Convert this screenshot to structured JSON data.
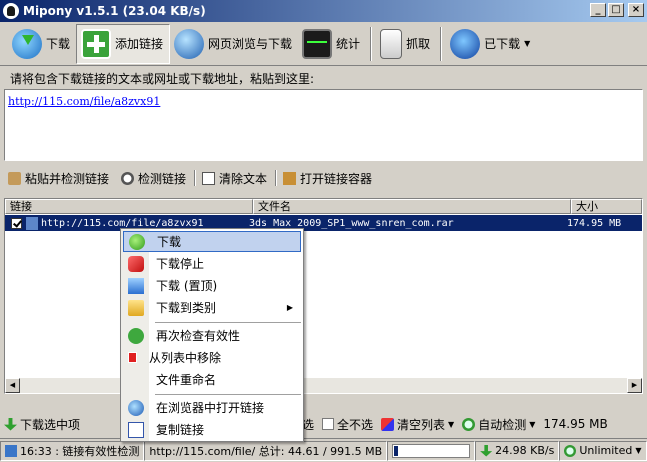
{
  "window": {
    "title": "Mipony v1.5.1 (23.04 KB/s)",
    "min": "_",
    "max": "□",
    "close": "×"
  },
  "toolbar": {
    "download": "下载",
    "add_links": "添加链接",
    "browse_download": "网页浏览与下载",
    "stats": "统计",
    "grab": "抓取",
    "downloaded": "已下载"
  },
  "prompt": "请将包含下载链接的文本或网址或下载地址，粘贴到这里:",
  "paste_text": "http://115.com/file/a8zvx91",
  "actions": {
    "paste_check": "粘贴并检测链接",
    "check": "检测链接",
    "clear_text": "清除文本",
    "open_container": "打开链接容器"
  },
  "list": {
    "columns": {
      "link": "链接",
      "filename": "文件名",
      "size": "大小"
    },
    "rows": [
      {
        "link": "http://115.com/file/a8zvx91",
        "filename": "3ds_Max_2009_SP1_www_snren_com.rar",
        "size": "174.95 MB"
      }
    ]
  },
  "context_menu": {
    "download": "下载",
    "stop": "下载停止",
    "download_top": "下载 (置顶)",
    "download_to": "下载到类别",
    "recheck": "再次检查有效性",
    "remove": "从列表中移除",
    "rename": "文件重命名",
    "open_browser": "在浏览器中打开链接",
    "copy_link": "复制链接",
    "submenu_arrow": "▶"
  },
  "bottom": {
    "download_selected": "下载选中项",
    "select_all_frag": "选",
    "deselect_all": "全不选",
    "clear_list": "清空列表",
    "auto_detect": "自动检测",
    "total_size": "174.95 MB"
  },
  "status": {
    "time_msg": "16:33 : 链接有效性检测",
    "url_total": "http://115.com/file/ 总计: 44.61 / 991.5 MB",
    "progress": 0.05,
    "speed": "24.98 KB/s",
    "limit": "Unlimited"
  }
}
